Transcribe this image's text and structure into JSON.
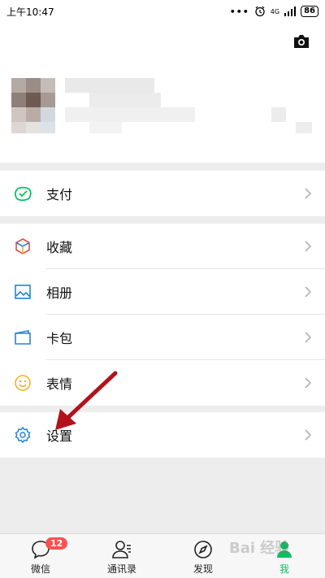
{
  "status_bar": {
    "time": "上午10:47",
    "dots": "•••",
    "signal": "4G",
    "battery": "86"
  },
  "profile": {
    "camera_icon": "camera-icon"
  },
  "menu": {
    "pay": {
      "label": "支付",
      "icon": "wallet-check-icon",
      "color": "#07c160"
    },
    "favorites": {
      "label": "收藏",
      "icon": "cube-icon"
    },
    "album": {
      "label": "相册",
      "icon": "image-icon",
      "color": "#2782d7"
    },
    "cards": {
      "label": "卡包",
      "icon": "card-icon",
      "color": "#2782d7"
    },
    "stickers": {
      "label": "表情",
      "icon": "smile-icon",
      "color": "#f0b327"
    },
    "settings": {
      "label": "设置",
      "icon": "gear-icon",
      "color": "#2782d7"
    }
  },
  "tabs": [
    {
      "label": "微信",
      "icon": "chat-icon",
      "badge": "12"
    },
    {
      "label": "通讯录",
      "icon": "contacts-icon"
    },
    {
      "label": "发现",
      "icon": "compass-icon"
    },
    {
      "label": "我",
      "icon": "me-icon",
      "active": true
    }
  ],
  "accent_color": "#07c160",
  "watermark": "Bai 经验"
}
